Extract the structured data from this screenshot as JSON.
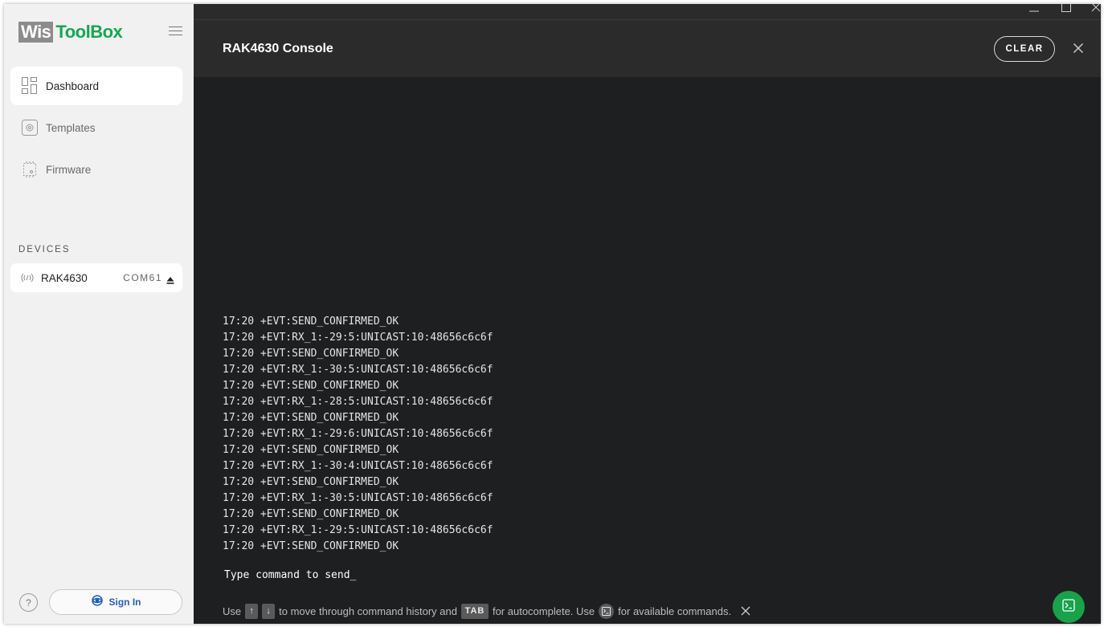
{
  "app": {
    "logo_part1": "Wis",
    "logo_part2": "ToolBox",
    "brand_green": "#14a854"
  },
  "sidebar": {
    "items": [
      {
        "label": "Dashboard",
        "icon": "dashboard-grid-icon",
        "active": true
      },
      {
        "label": "Templates",
        "icon": "templates-icon",
        "active": false
      },
      {
        "label": "Firmware",
        "icon": "chip-icon",
        "active": false
      }
    ],
    "devices_header": "DEVICES",
    "devices": [
      {
        "name": "RAK4630",
        "port": "COM61",
        "icon": "wireless-signal-icon"
      }
    ],
    "help_label": "?",
    "signin_label": "Sign In"
  },
  "console": {
    "title": "RAK4630 Console",
    "clear_label": "CLEAR",
    "lines": [
      "17:20 +EVT:SEND_CONFIRMED_OK",
      "17:20 +EVT:RX_1:-29:5:UNICAST:10:48656c6c6f",
      "17:20 +EVT:SEND_CONFIRMED_OK",
      "17:20 +EVT:RX_1:-30:5:UNICAST:10:48656c6c6f",
      "17:20 +EVT:SEND_CONFIRMED_OK",
      "17:20 +EVT:RX_1:-28:5:UNICAST:10:48656c6c6f",
      "17:20 +EVT:SEND_CONFIRMED_OK",
      "17:20 +EVT:RX_1:-29:6:UNICAST:10:48656c6c6f",
      "17:20 +EVT:SEND_CONFIRMED_OK",
      "17:20 +EVT:RX_1:-30:4:UNICAST:10:48656c6c6f",
      "17:20 +EVT:SEND_CONFIRMED_OK",
      "17:20 +EVT:RX_1:-30:5:UNICAST:10:48656c6c6f",
      "17:20 +EVT:SEND_CONFIRMED_OK",
      "17:20 +EVT:RX_1:-29:5:UNICAST:10:48656c6c6f",
      "17:20 +EVT:SEND_CONFIRMED_OK"
    ],
    "input_placeholder": "Type command to send_",
    "hint": {
      "use1": "Use",
      "key_up": "↑",
      "key_down": "↓",
      "mid1": "to move through command history and",
      "key_tab": "TAB",
      "mid2": "for autocomplete. Use",
      "end": "for available commands."
    }
  },
  "colors": {
    "console_bg": "#1e1f21",
    "console_header_bg": "#2b2b2b",
    "fab_green": "#16a34a",
    "signin_blue": "#1f5fbf"
  }
}
